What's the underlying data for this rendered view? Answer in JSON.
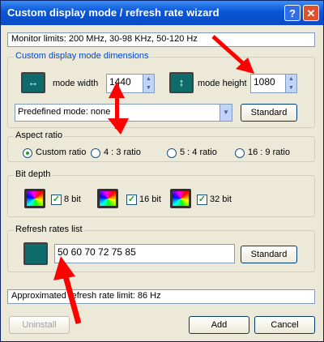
{
  "window": {
    "title": "Custom display mode / refresh rate wizard"
  },
  "titlebar_buttons": {
    "help": "?",
    "close": "✕"
  },
  "monitor_limits": "Monitor limits: 200 MHz, 30-98 KHz, 50-120 Hz",
  "dimensions": {
    "legend": "Custom display mode dimensions",
    "width_label": "mode width",
    "width_value": "1440",
    "height_label": "mode height",
    "height_value": "1080",
    "predefined_selected": "Predefined mode: none",
    "standard_button": "Standard"
  },
  "aspect_ratio": {
    "legend": "Aspect ratio",
    "options": [
      "Custom ratio",
      "4 : 3 ratio",
      "5 : 4 ratio",
      "16 : 9 ratio"
    ],
    "selected_index": 0
  },
  "bit_depth": {
    "legend": "Bit depth",
    "options": [
      "8 bit",
      "16 bit",
      "32 bit"
    ],
    "checked": [
      true,
      true,
      true
    ]
  },
  "refresh": {
    "legend": "Refresh rates list",
    "value": "50 60 70 72 75 85",
    "standard_button": "Standard"
  },
  "approx_limit": "Approximated refresh rate limit: 86 Hz",
  "buttons": {
    "uninstall": "Uninstall",
    "add": "Add",
    "cancel": "Cancel"
  },
  "colors": {
    "titlebar": "#0b55d6",
    "annotation_arrow": "#ff0000",
    "accent_check": "#21a121"
  }
}
